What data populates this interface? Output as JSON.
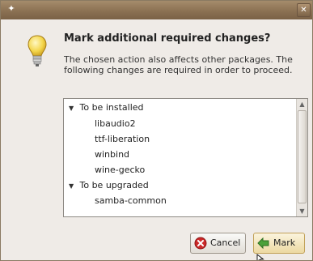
{
  "dialog": {
    "title": "Mark additional required changes?",
    "description": "The chosen action also affects other packages. The following changes are required in order to proceed."
  },
  "changes": {
    "groups": [
      {
        "label": "To be installed",
        "expanded": true,
        "items": [
          "libaudio2",
          "ttf-liberation",
          "winbind",
          "wine-gecko"
        ]
      },
      {
        "label": "To be upgraded",
        "expanded": true,
        "items": [
          "samba-common"
        ]
      }
    ]
  },
  "buttons": {
    "cancel": "Cancel",
    "mark": "Mark"
  },
  "icons": {
    "dialog": "lightbulb-icon",
    "cancel": "cancel-icon",
    "mark": "mark-arrow-icon"
  },
  "colors": {
    "titlebar": "#8b7153",
    "dialog_bg": "#efebe7",
    "mark_button": "#ecd9a2"
  }
}
